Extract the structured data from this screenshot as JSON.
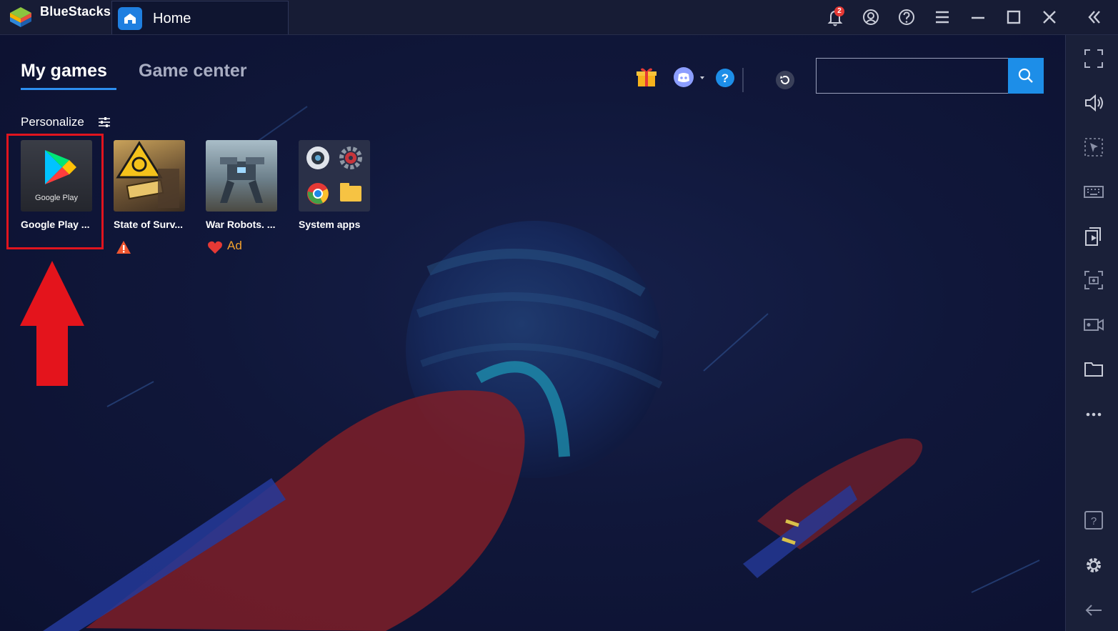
{
  "window": {
    "app_name": "BlueStacks",
    "home_tab_label": "Home",
    "notification_count": "2"
  },
  "main": {
    "tabs": [
      {
        "label": "My games",
        "active": true
      },
      {
        "label": "Game center",
        "active": false
      }
    ],
    "personalize_label": "Personalize",
    "search": {
      "value": "",
      "placeholder": ""
    },
    "games": [
      {
        "label": "Google Play ...",
        "icon": "google-play-icon",
        "sub": ""
      },
      {
        "label": "State of Surv...",
        "icon": "state-of-survival-thumbnail",
        "sub": "warning-icon"
      },
      {
        "label": "War Robots. ...",
        "icon": "war-robots-thumbnail",
        "sub": "Ad"
      },
      {
        "label": "System apps",
        "icon": "system-apps-folder",
        "sub": ""
      }
    ]
  },
  "colors": {
    "accent": "#1d8ee8",
    "highlight": "#e0141e",
    "background": "#0f1530",
    "ad_text": "#f3a12c"
  },
  "sidebar_icons": [
    "fullscreen-icon",
    "volume-icon",
    "select-pointer-icon",
    "keyboard-icon",
    "install-apk-icon",
    "screenshot-icon",
    "record-icon",
    "folder-icon",
    "more-icon",
    "help-icon",
    "settings-icon",
    "back-icon"
  ]
}
